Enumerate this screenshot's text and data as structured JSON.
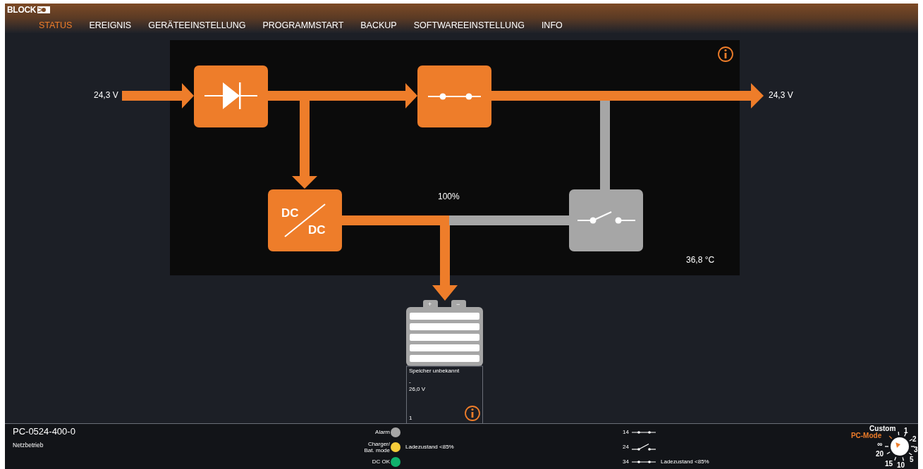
{
  "header": {
    "logo": "BLOCK"
  },
  "nav": [
    {
      "label": "STATUS",
      "selected": true
    },
    {
      "label": "EREIGNIS",
      "selected": false
    },
    {
      "label": "GERÄTEEINSTELLUNG",
      "selected": false
    },
    {
      "label": "PROGRAMMSTART",
      "selected": false
    },
    {
      "label": "BACKUP",
      "selected": false
    },
    {
      "label": "SOFTWAREEINSTELLUNG",
      "selected": false
    },
    {
      "label": "INFO",
      "selected": false
    }
  ],
  "diagram": {
    "input_voltage": "24,3 V",
    "output_voltage": "24,3 V",
    "load": "100%",
    "temperature": "36,8 °C",
    "converter_label": [
      "DC",
      "DC"
    ],
    "output_switch": {
      "closed": true
    },
    "battery_switch": {
      "closed": false
    }
  },
  "battery": {
    "terminals": [
      "+",
      "−"
    ],
    "title": "Speicher unbekannt",
    "line_2": "-",
    "voltage": "26,0 V",
    "number": "1"
  },
  "footer": {
    "device": "PC-0524-400-0",
    "mode": "Netzbetrieb",
    "leds": [
      {
        "label": "Alarm",
        "color": "#a6a6a6"
      },
      {
        "label": "Charger/\nBat. mode",
        "color": "#f5cc3a",
        "note": "Ladezustand <85%"
      },
      {
        "label": "DC OK",
        "color": "#10b26c"
      }
    ],
    "relays": [
      {
        "number": "14",
        "closed": true
      },
      {
        "number": "24",
        "closed": false
      },
      {
        "number": "34",
        "closed": true,
        "note": "Ladezustand <85%"
      }
    ],
    "dial": [
      {
        "label": "Custom",
        "selected": false
      },
      {
        "label": "1",
        "selected": false
      },
      {
        "label": "PC-Mode",
        "selected": true
      },
      {
        "label": "2",
        "selected": false
      },
      {
        "label": "∞",
        "selected": false
      },
      {
        "label": "3",
        "selected": false
      },
      {
        "label": "20",
        "selected": false
      },
      {
        "label": "5",
        "selected": false
      },
      {
        "label": "15",
        "selected": false
      },
      {
        "label": "10",
        "selected": false
      }
    ]
  }
}
